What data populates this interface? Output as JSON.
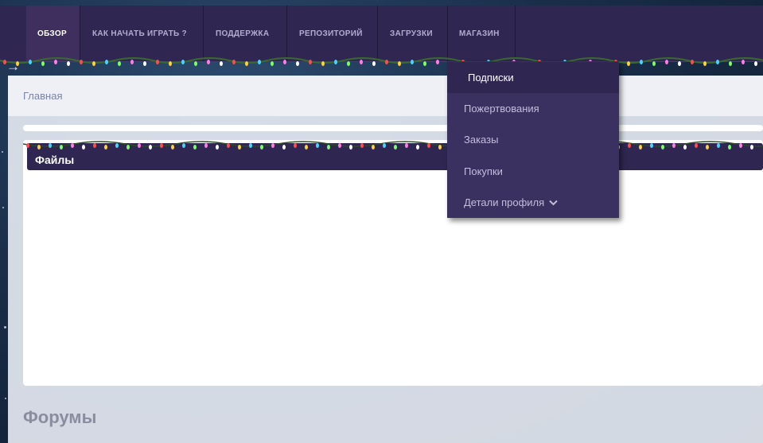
{
  "nav": {
    "tabs": [
      {
        "label": "ОБЗОР",
        "active": true
      },
      {
        "label": "КАК НАЧАТЬ ИГРАТЬ ?"
      },
      {
        "label": "ПОДДЕРЖКА"
      },
      {
        "label": "РЕПОЗИТОРИЙ"
      },
      {
        "label": "ЗАГРУЗКИ"
      },
      {
        "label": "МАГАЗИН"
      }
    ]
  },
  "breadcrumb": {
    "home_label": "Главная"
  },
  "dropdown": {
    "items": [
      {
        "label": "Подписки",
        "active": true
      },
      {
        "label": "Пожертвования"
      },
      {
        "label": "Заказы"
      },
      {
        "label": "Покупки"
      },
      {
        "label": "Детали профиля"
      }
    ]
  },
  "files": {
    "title": "Файлы"
  },
  "forums": {
    "title": "Форумы"
  },
  "icons": {
    "back": "arrow-right-icon",
    "profile_chevron": "chevron-down-icon"
  },
  "colors": {
    "nav_bg": "#2f2751",
    "dropdown_bg": "#3b3160",
    "breadcrumb_bg": "#eef0f6",
    "text_muted": "#7a83a8"
  }
}
